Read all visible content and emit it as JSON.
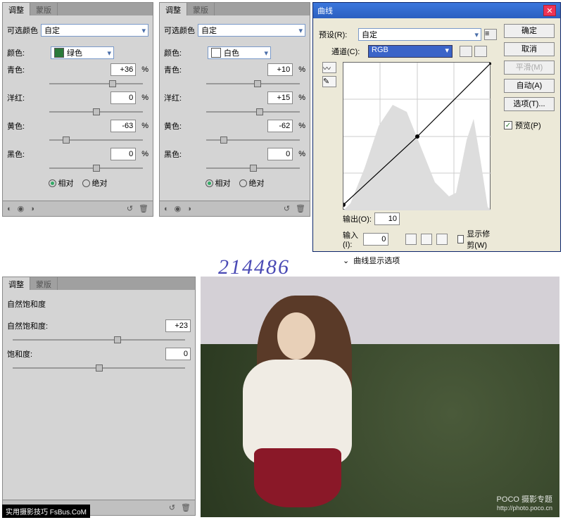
{
  "tabs": {
    "adjust": "调整",
    "mask": "蒙版"
  },
  "selColor": {
    "title": "可选颜色",
    "preset": "自定",
    "colorLabel": "颜色:",
    "sliders": {
      "cyan": "青色:",
      "magenta": "洋红:",
      "yellow": "黄色:",
      "black": "黑色:"
    },
    "pct": "%",
    "relative": "相对",
    "absolute": "绝对"
  },
  "panel1": {
    "colorName": "绿色",
    "swatch": "#2a7a3a",
    "cyan": "+36",
    "magenta": "0",
    "yellow": "-63",
    "black": "0"
  },
  "panel2": {
    "colorName": "白色",
    "swatch": "#ffffff",
    "cyan": "+10",
    "magenta": "+15",
    "yellow": "-62",
    "black": "0"
  },
  "curves": {
    "title": "曲线",
    "presetLabel": "预设(R):",
    "preset": "自定",
    "channelLabel": "通道(C):",
    "channel": "RGB",
    "outputLabel": "输出(O):",
    "output": "10",
    "inputLabel": "输入(I):",
    "input": "0",
    "showClip": "显示修剪(W)",
    "expand": "曲线显示选项",
    "ok": "确定",
    "cancel": "取消",
    "smooth": "平滑(M)",
    "auto": "自动(A)",
    "options": "选项(T)...",
    "preview": "预览(P)"
  },
  "vibrance": {
    "title": "自然饱和度",
    "vibLabel": "自然饱和度:",
    "vib": "+23",
    "satLabel": "饱和度:",
    "sat": "0"
  },
  "watermarkNum": "214486",
  "photoWm": {
    "brand": "POCO 摄影专题",
    "url": "http://photo.poco.cn"
  },
  "bottomTag": "实用摄影技巧 FsBus.CoM",
  "chart_data": {
    "type": "line",
    "title": "曲线 RGB",
    "xlabel": "输入",
    "ylabel": "输出",
    "xlim": [
      0,
      255
    ],
    "ylim": [
      0,
      255
    ],
    "series": [
      {
        "name": "curve",
        "x": [
          0,
          128,
          255
        ],
        "y": [
          10,
          128,
          255
        ]
      }
    ]
  }
}
